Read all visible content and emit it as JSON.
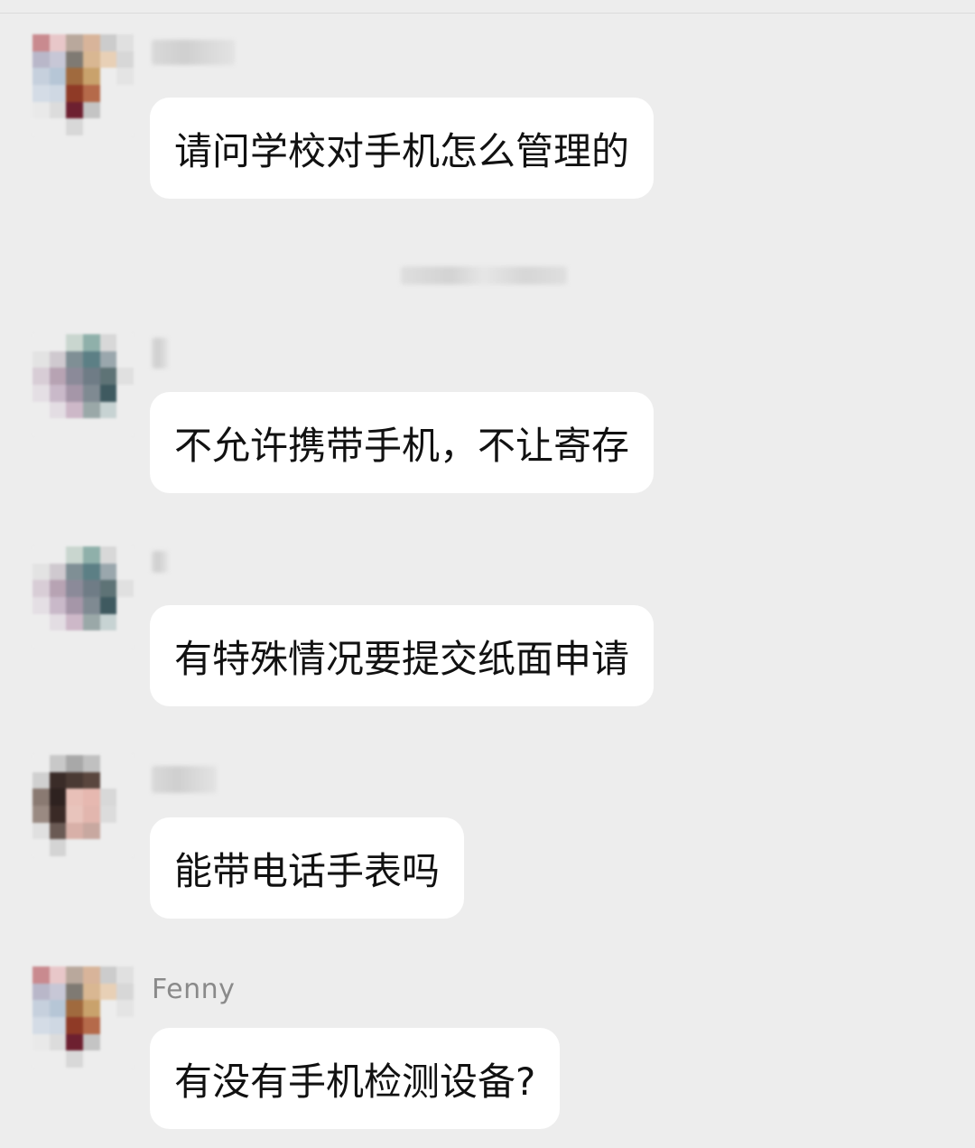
{
  "messages": [
    {
      "sender": "",
      "text": "请问学校对手机怎么管理的",
      "avatar_colors": [
        "#c98a8f",
        "#e8c7c9",
        "#b9a89c",
        "#d8b49a",
        "#ccc",
        "#e0e0e0",
        "#b9b7c9",
        "#c7c7d6",
        "#7f7a73",
        "#d9b792",
        "#e8d0b6",
        "#d7d7d7",
        "#c6d0dd",
        "#b6c6d6",
        "#a06a3e",
        "#c9a26c",
        "#ededed",
        "#e4e4e4",
        "#d4dce6",
        "#cfd8e3",
        "#8f3a26",
        "#b56a4a",
        "#ededed",
        "#ededed",
        "#e9e9e9",
        "#dcdcdc",
        "#6d2030",
        "#c4c4c4",
        "#ededed",
        "#ededed",
        "#ededed",
        "#ededed",
        "#d8d8d8",
        "#ededed",
        "#ededed",
        "#ededed"
      ]
    },
    {
      "sender": "",
      "text": "不允许携带手机，不让寄存",
      "avatar_colors": [
        "#ededed",
        "#ededed",
        "#c9d6cf",
        "#8fb0aa",
        "#d8d8d8",
        "#ededed",
        "#e3e3e3",
        "#cfc9cf",
        "#7f8f95",
        "#5c7f85",
        "#9aa7ad",
        "#ededed",
        "#d8cdd6",
        "#b7a3b3",
        "#8b8a99",
        "#6f7c86",
        "#5e7376",
        "#e0e0e0",
        "#e4dfe4",
        "#c9b9c9",
        "#a596a8",
        "#7f8a92",
        "#3f5a60",
        "#ededed",
        "#ededed",
        "#e3dde3",
        "#cdb8c8",
        "#9aa8a8",
        "#c7d3d3",
        "#ededed",
        "#ededed",
        "#ededed",
        "#ededed",
        "#ededed",
        "#ededed",
        "#ededed"
      ]
    },
    {
      "sender": "",
      "text": "有特殊情况要提交纸面申请",
      "avatar_colors": [
        "#ededed",
        "#ededed",
        "#c9d6cf",
        "#8fb0aa",
        "#d8d8d8",
        "#ededed",
        "#e3e3e3",
        "#cfc9cf",
        "#7f8f95",
        "#5c7f85",
        "#9aa7ad",
        "#ededed",
        "#d8cdd6",
        "#b7a3b3",
        "#8b8a99",
        "#6f7c86",
        "#5e7376",
        "#e0e0e0",
        "#e4dfe4",
        "#c9b9c9",
        "#a596a8",
        "#7f8a92",
        "#3f5a60",
        "#ededed",
        "#ededed",
        "#e3dde3",
        "#cdb8c8",
        "#9aa8a8",
        "#c7d3d3",
        "#ededed",
        "#ededed",
        "#ededed",
        "#ededed",
        "#ededed",
        "#ededed",
        "#ededed"
      ]
    },
    {
      "sender": "",
      "text": "能带电话手表吗",
      "avatar_colors": [
        "#ededed",
        "#c8c8c8",
        "#a8a8a8",
        "#c0c0c0",
        "#ededed",
        "#ededed",
        "#d0d0d0",
        "#3a2c28",
        "#4a3a34",
        "#5a463e",
        "#ededed",
        "#ededed",
        "#8a7a72",
        "#2e2220",
        "#e8c0b8",
        "#e6b8b0",
        "#d8d8d8",
        "#ededed",
        "#9a8a82",
        "#3a2a26",
        "#e8c4bc",
        "#e2b6ae",
        "#dcdcdc",
        "#ededed",
        "#e0e0e0",
        "#6a5a54",
        "#d8b0a8",
        "#c8a8a0",
        "#ededed",
        "#ededed",
        "#ededed",
        "#d4d4d4",
        "#ededed",
        "#ededed",
        "#ededed",
        "#ededed"
      ]
    },
    {
      "sender": "Fenny",
      "text": "有没有手机检测设备?",
      "avatar_colors": [
        "#c98a8f",
        "#e8c7c9",
        "#b9a89c",
        "#d8b49a",
        "#ccc",
        "#e0e0e0",
        "#b9b7c9",
        "#c7c7d6",
        "#7f7a73",
        "#d9b792",
        "#e8d0b6",
        "#d7d7d7",
        "#c6d0dd",
        "#b6c6d6",
        "#a06a3e",
        "#c9a26c",
        "#ededed",
        "#e4e4e4",
        "#d4dce6",
        "#cfd8e3",
        "#8f3a26",
        "#b56a4a",
        "#ededed",
        "#ededed",
        "#e9e9e9",
        "#dcdcdc",
        "#6d2030",
        "#c4c4c4",
        "#ededed",
        "#ededed",
        "#ededed",
        "#ededed",
        "#d8d8d8",
        "#ededed",
        "#ededed",
        "#ededed"
      ]
    }
  ]
}
